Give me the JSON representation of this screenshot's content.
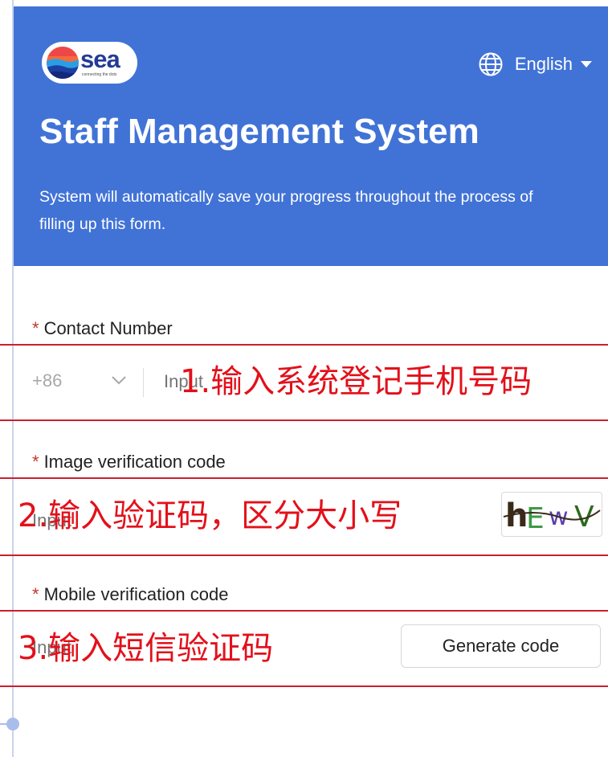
{
  "header": {
    "brand": "sea",
    "brand_tagline": "connecting the dots",
    "language": "English",
    "title": "Staff Management System",
    "subtitle": "System will automatically save your progress throughout the process of filling up this form."
  },
  "form": {
    "required_mark": "*",
    "contact": {
      "label": "Contact Number",
      "country_code": "+86",
      "placeholder": "Input"
    },
    "image_code": {
      "label": "Image verification code",
      "placeholder": "Input",
      "captcha_text": "hEwV"
    },
    "mobile_code": {
      "label": "Mobile verification code",
      "placeholder": "Input",
      "generate_label": "Generate code"
    }
  },
  "annotations": {
    "step1": "1.输入系统登记手机号码",
    "step2": "2.输入验证码，区分大小写",
    "step3": "3.输入短信验证码"
  },
  "colors": {
    "header_bg": "#4173d6",
    "annotation": "#e3101a",
    "required": "#c0392b"
  },
  "icons": [
    "globe-icon",
    "caret-down-icon",
    "chevron-down-icon"
  ]
}
